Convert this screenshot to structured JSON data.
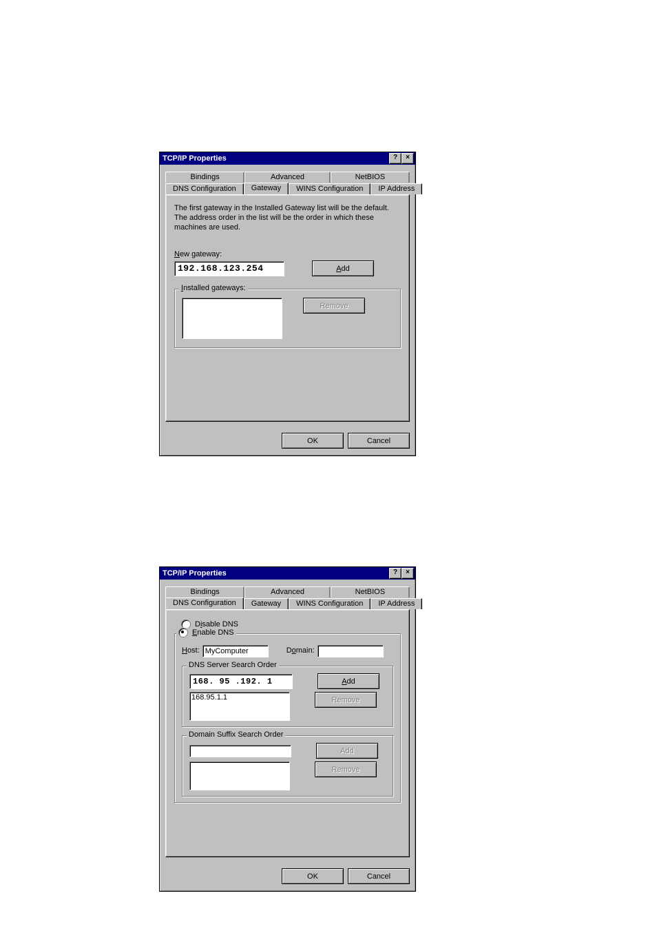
{
  "dialog1": {
    "title": "TCP/IP Properties",
    "tabs_row1": [
      "Bindings",
      "Advanced",
      "NetBIOS"
    ],
    "tabs_row2": [
      "DNS Configuration",
      "Gateway",
      "WINS Configuration",
      "IP Address"
    ],
    "active_tab": "Gateway",
    "description": "The first gateway in the Installed Gateway list will be the default. The address order in the list will be the order in which these machines are used.",
    "new_gateway_label": "New gateway:",
    "new_gateway_value": "192.168.123.254",
    "add_label": "Add",
    "installed_label": "Installed gateways:",
    "remove_label": "Remove",
    "ok_label": "OK",
    "cancel_label": "Cancel"
  },
  "dialog2": {
    "title": "TCP/IP Properties",
    "tabs_row1": [
      "Bindings",
      "Advanced",
      "NetBIOS"
    ],
    "tabs_row2": [
      "DNS Configuration",
      "Gateway",
      "WINS Configuration",
      "IP Address"
    ],
    "active_tab": "DNS Configuration",
    "disable_label": "Disable DNS",
    "enable_label": "Enable DNS",
    "dns_enabled": true,
    "host_label": "Host:",
    "host_value": "MyComputer",
    "domain_label": "Domain:",
    "domain_value": "",
    "dns_order_label": "DNS Server Search Order",
    "dns_input_value": "168. 95 .192. 1",
    "dns_list": [
      "168.95.1.1"
    ],
    "add_label": "Add",
    "remove_label": "Remove",
    "suffix_label": "Domain Suffix Search Order",
    "suffix_input_value": "",
    "suffix_list": [],
    "suffix_add_label": "Add",
    "suffix_remove_label": "Remove",
    "ok_label": "OK",
    "cancel_label": "Cancel"
  }
}
